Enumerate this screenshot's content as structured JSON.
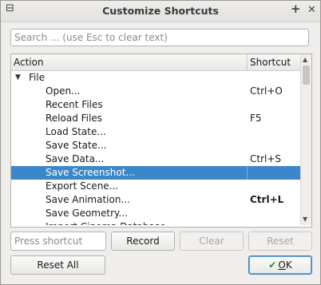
{
  "window": {
    "title": "Customize Shortcuts",
    "help_glyph": "+",
    "close_glyph": "✕",
    "menu_glyph": "⊟"
  },
  "search": {
    "placeholder": "Search ... (use Esc to clear text)",
    "value": ""
  },
  "tree": {
    "headers": {
      "action": "Action",
      "shortcut": "Shortcut"
    },
    "group": {
      "label": "File",
      "expanded": true
    },
    "rows": [
      {
        "name": "Open...",
        "shortcut": "Ctrl+O"
      },
      {
        "name": "Recent Files",
        "shortcut": ""
      },
      {
        "name": "Reload Files",
        "shortcut": "F5"
      },
      {
        "name": "Load State...",
        "shortcut": ""
      },
      {
        "name": "Save State...",
        "shortcut": ""
      },
      {
        "name": "Save Data...",
        "shortcut": "Ctrl+S"
      },
      {
        "name": "Save Screenshot...",
        "shortcut": "",
        "selected": true
      },
      {
        "name": "Export Scene...",
        "shortcut": ""
      },
      {
        "name": "Save Animation...",
        "shortcut": "Ctrl+L",
        "bold_shortcut": true
      },
      {
        "name": "Save Geometry...",
        "shortcut": ""
      },
      {
        "name": "Import Cinema Database...",
        "shortcut": ""
      }
    ]
  },
  "shortcut_input": {
    "placeholder": "Press shortcut",
    "value": ""
  },
  "buttons": {
    "record": "Record",
    "clear": "Clear",
    "reset": "Reset",
    "reset_all": "Reset All",
    "ok_first": "O",
    "ok_rest": "K"
  },
  "colors": {
    "selection": "#3c87c9",
    "accent": "#3b7fc2"
  }
}
